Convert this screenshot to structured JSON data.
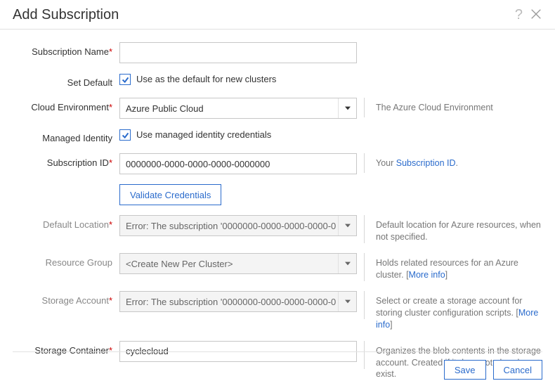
{
  "header": {
    "title": "Add Subscription"
  },
  "fields": {
    "subscription_name": {
      "label": "Subscription Name",
      "value": ""
    },
    "set_default": {
      "label": "Set Default",
      "text": "Use as the default for new clusters"
    },
    "cloud_env": {
      "label": "Cloud Environment",
      "value": "Azure Public Cloud",
      "info": "The Azure Cloud Environment"
    },
    "managed_identity": {
      "label": "Managed Identity",
      "text": "Use managed identity credentials"
    },
    "subscription_id": {
      "label": "Subscription ID",
      "value": "0000000-0000-0000-0000-0000000",
      "info_pre": "Your ",
      "info_link": "Subscription ID",
      "info_post": "."
    },
    "validate": {
      "label": "Validate Credentials"
    },
    "default_location": {
      "label": "Default Location",
      "value": "Error: The subscription '0000000-0000-0000-0000-0",
      "info": "Default location for Azure resources, when not specified."
    },
    "resource_group": {
      "label": "Resource Group",
      "value": "<Create New Per Cluster>",
      "info_pre": "Holds related resources for an Azure cluster. [",
      "info_link": "More info",
      "info_post": "]"
    },
    "storage_account": {
      "label": "Storage Account",
      "value": "Error: The subscription '0000000-0000-0000-0000-0",
      "info_pre": "Select or create a storage account for storing cluster configuration scripts. [",
      "info_link": "More info",
      "info_post": "]"
    },
    "storage_container": {
      "label": "Storage Container",
      "value": "cyclecloud",
      "info": "Organizes the blob contents in the storage account. Created if it does not already exist."
    }
  },
  "footer": {
    "save": "Save",
    "cancel": "Cancel"
  }
}
